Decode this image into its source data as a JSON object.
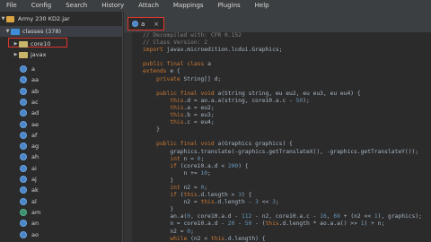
{
  "menu": [
    "File",
    "Config",
    "Search",
    "History",
    "Attach",
    "Mappings",
    "Plugins",
    "Help"
  ],
  "tree": {
    "root_label": "Army 230 KD2.jar",
    "classes_label": "classes (378)",
    "packages": [
      "core10",
      "javax"
    ],
    "class_items": [
      "a",
      "aa",
      "ab",
      "ac",
      "ad",
      "ae",
      "af",
      "ag",
      "ah",
      "ai",
      "aj",
      "ak",
      "al",
      "am",
      "an",
      "ao"
    ]
  },
  "tab": {
    "label": "a",
    "close": "×"
  },
  "code_lines": [
    "// Decompiled with: CFR 0.152",
    "// Class Version: 2",
    "import javax.microedition.lcdui.Graphics;",
    "",
    "public final class a",
    "extends e {",
    "    private String[] d;",
    "",
    "    public final void a(String string, eu eu2, eu eu3, eu eu4) {",
    "        this.d = ao.a.a(string, core10.a.c - 50);",
    "        this.a = eu2;",
    "        this.b = eu3;",
    "        this.c = eu4;",
    "    }",
    "",
    "    public final void a(Graphics graphics) {",
    "        graphics.translate(-graphics.getTranslateX(), -graphics.getTranslateY());",
    "        int n = 0;",
    "        if (core10.a.d < 200) {",
    "            n += 10;",
    "        }",
    "        int n2 = 0;",
    "        if (this.d.length > 3) {",
    "            n2 = this.d.length - 3 << 3;",
    "        }",
    "        an.a(0, core10.a.d - 112 - n2, core10.a.c - 16, 69 + (n2 << 1), graphics);",
    "        n = core10.a.d - 20 - 50 - (this.d.length * ao.a.a() >> 1) + n;",
    "        n2 = 0;",
    "        while (n2 < this.d.length) {"
  ]
}
